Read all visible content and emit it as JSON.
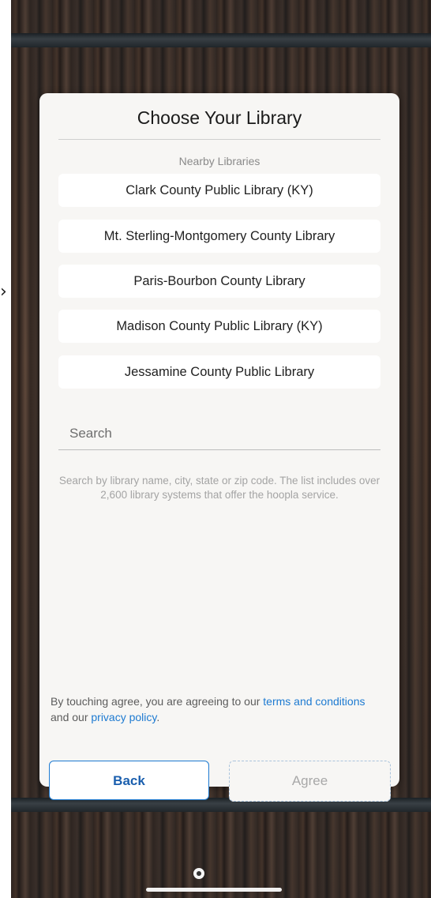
{
  "modal": {
    "title": "Choose Your Library",
    "nearby_label": "Nearby Libraries",
    "libraries": [
      "Clark County Public Library (KY)",
      "Mt. Sterling-Montgomery County Library",
      "Paris-Bourbon County Library",
      "Madison County Public Library (KY)",
      "Jessamine County Public Library"
    ],
    "search_placeholder": "Search",
    "search_hint": "Search by library name, city, state or zip code. The list includes over 2,600 library systems that offer the hoopla service.",
    "terms": {
      "prefix": "By touching agree, you are agreeing to our ",
      "terms_link": "terms and conditions",
      "middle": " and our ",
      "privacy_link": "privacy policy",
      "suffix": "."
    },
    "back_label": "Back",
    "agree_label": "Agree"
  },
  "icons": {
    "side_arrow": "chevron-right-icon"
  },
  "colors": {
    "accent": "#1d7ad1",
    "card_bg": "#f7f6f4",
    "disabled_text": "#a8a8a8"
  }
}
